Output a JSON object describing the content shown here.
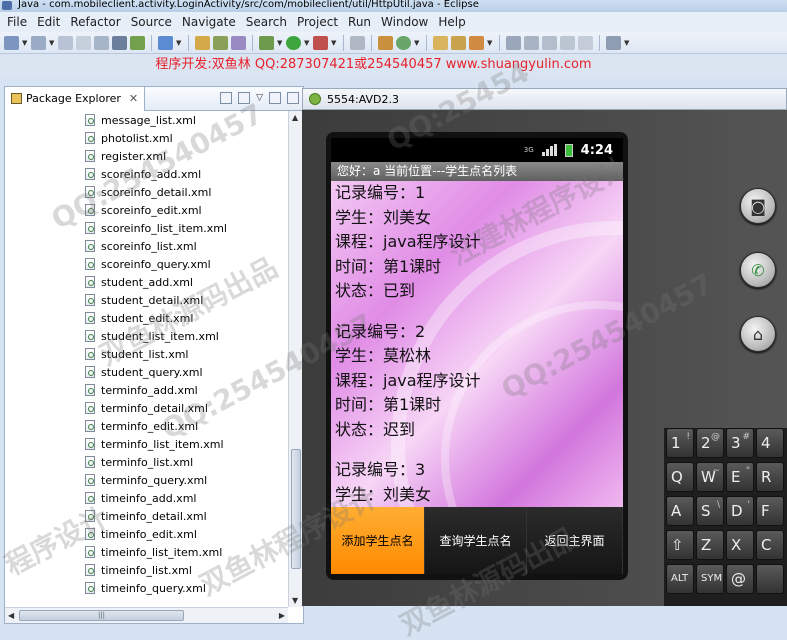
{
  "window": {
    "title": "Java - com.mobileclient.activity.LoginActivity/src/com/mobileclient/util/HttpUtil.java - Eclipse"
  },
  "menu": [
    "File",
    "Edit",
    "Refactor",
    "Source",
    "Navigate",
    "Search",
    "Project",
    "Run",
    "Window",
    "Help"
  ],
  "banner": {
    "text": "程序开发:双鱼林 QQ:287307421或254540457 www.shuangyulin.com",
    "color": "#e8212a"
  },
  "package_explorer": {
    "tab_label": "Package Explorer",
    "files": [
      "message_list.xml",
      "photolist.xml",
      "register.xml",
      "scoreinfo_add.xml",
      "scoreinfo_detail.xml",
      "scoreinfo_edit.xml",
      "scoreinfo_list_item.xml",
      "scoreinfo_list.xml",
      "scoreinfo_query.xml",
      "student_add.xml",
      "student_detail.xml",
      "student_edit.xml",
      "student_list_item.xml",
      "student_list.xml",
      "student_query.xml",
      "terminfo_add.xml",
      "terminfo_detail.xml",
      "terminfo_edit.xml",
      "terminfo_list_item.xml",
      "terminfo_list.xml",
      "terminfo_query.xml",
      "timeinfo_add.xml",
      "timeinfo_detail.xml",
      "timeinfo_edit.xml",
      "timeinfo_list_item.xml",
      "timeinfo_list.xml",
      "timeinfo_query.xml"
    ]
  },
  "emulator": {
    "title": "5554:AVD2.3",
    "status": {
      "network": "3G",
      "time": "4:24"
    },
    "app_title": "您好：a   当前位置---学生点名列表",
    "records": [
      {
        "id": "记录编号：1",
        "student": "学生：刘美女",
        "course": "课程：java程序设计",
        "time": "时间：第1课时",
        "state": "状态：已到"
      },
      {
        "id": "记录编号：2",
        "student": "学生：莫松林",
        "course": "课程：java程序设计",
        "time": "时间：第1课时",
        "state": "状态：迟到"
      },
      {
        "id": "记录编号：3",
        "student": "学生：刘美女"
      }
    ],
    "buttons": {
      "add": "添加学生点名",
      "query": "查询学生点名",
      "back": "返回主界面"
    },
    "keyboard": {
      "row1": [
        {
          "k": "1",
          "s": "!"
        },
        {
          "k": "2",
          "s": "@"
        },
        {
          "k": "3",
          "s": "#"
        },
        {
          "k": "4",
          "s": ""
        }
      ],
      "row2": [
        {
          "k": "Q",
          "s": ""
        },
        {
          "k": "W",
          "s": "~"
        },
        {
          "k": "E",
          "s": "\""
        },
        {
          "k": "R",
          "s": ""
        }
      ],
      "row3": [
        {
          "k": "A",
          "s": ""
        },
        {
          "k": "S",
          "s": "\\"
        },
        {
          "k": "D",
          "s": "'"
        },
        {
          "k": "F",
          "s": ""
        }
      ],
      "row4": [
        {
          "k": "⇧",
          "s": ""
        },
        {
          "k": "Z",
          "s": ""
        },
        {
          "k": "X",
          "s": ""
        },
        {
          "k": "C",
          "s": ""
        }
      ],
      "row5": [
        {
          "k": "ALT",
          "s": ""
        },
        {
          "k": "SYM",
          "s": ""
        },
        {
          "k": "@",
          "s": ""
        },
        {
          "k": "",
          "s": ""
        }
      ]
    }
  },
  "watermarks": [
    "QQ:254540457",
    "双鱼林源码出品",
    "双鱼林程序设计",
    "QQ:254540457",
    "程序设计",
    "QQ:254540457",
    "汪建林程序设计",
    "QQ:25454",
    "双鱼林源码出品"
  ]
}
